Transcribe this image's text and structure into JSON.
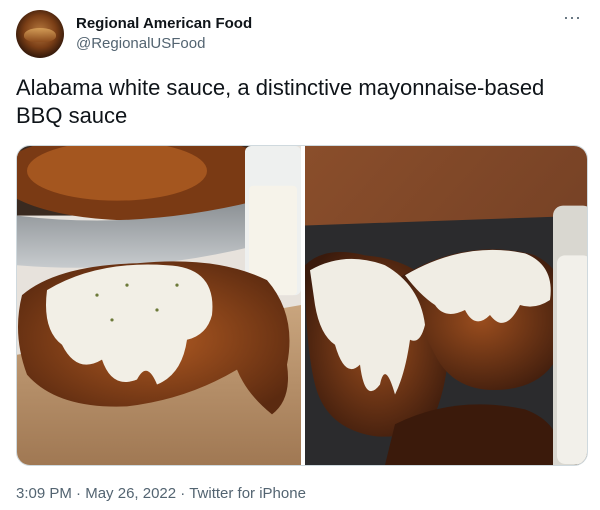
{
  "tweet": {
    "author_name": "Regional American Food",
    "author_handle": "@RegionalUSFood",
    "more_icon": "more-horizontal-icon",
    "text": "Alabama white sauce, a distinctive mayonnaise-based BBQ sauce",
    "media": [
      {
        "icon": "photo"
      },
      {
        "icon": "photo"
      }
    ],
    "time": "3:09 PM",
    "separator": " · ",
    "date": "May 26, 2022",
    "source": "Twitter for iPhone"
  },
  "colors": {
    "text": "#0f1419",
    "secondary": "#536471",
    "border": "#cfd9de"
  }
}
